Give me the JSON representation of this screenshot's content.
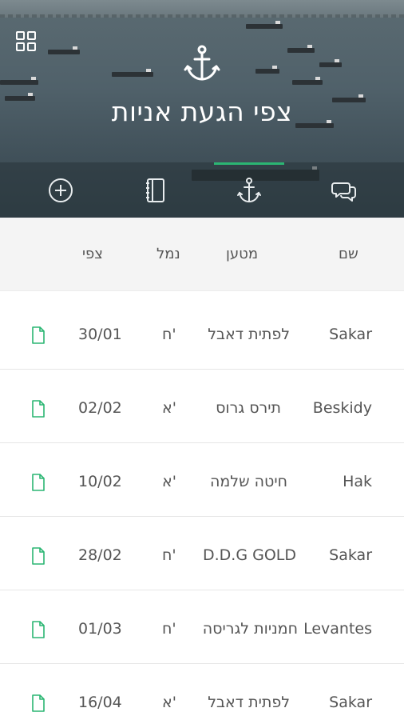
{
  "header": {
    "title": "צפי הגעת אניות"
  },
  "icons": {
    "menu": "grid-icon",
    "header_logo": "anchor-icon"
  },
  "tabs": [
    {
      "name": "tab-add",
      "icon": "plus-circle-icon",
      "active": false
    },
    {
      "name": "tab-notebook",
      "icon": "notebook-icon",
      "active": false
    },
    {
      "name": "tab-ships",
      "icon": "anchor-icon",
      "active": true
    },
    {
      "name": "tab-chat",
      "icon": "chat-bubbles-icon",
      "active": false
    }
  ],
  "colors": {
    "accent": "#2bb673",
    "doc_icon": "#2bb673",
    "header_bg": "#f4f4f4"
  },
  "table": {
    "headers": {
      "name": "שם",
      "loader": "מטען",
      "port": "נמל",
      "eta": "צפי"
    },
    "rows": [
      {
        "name": "Sakar",
        "cargo": "לפתית דאבל",
        "port": "ח'",
        "eta": "30/01",
        "icon": "document-icon"
      },
      {
        "name": "Beskidy",
        "cargo": "תירס גרוס",
        "port": "א'",
        "eta": "02/02",
        "icon": "document-icon"
      },
      {
        "name": "Hak",
        "cargo": "חיטה שלמה",
        "port": "א'",
        "eta": "10/02",
        "icon": "document-icon"
      },
      {
        "name": "Sakar",
        "cargo": "D.D.G GOLD",
        "port": "ח'",
        "eta": "28/02",
        "icon": "document-icon"
      },
      {
        "name": "Levantes",
        "cargo": "חמניות לגריסה",
        "port": "ח'",
        "eta": "01/03",
        "icon": "document-icon"
      },
      {
        "name": "Sakar",
        "cargo": "לפתית דאבל",
        "port": "א'",
        "eta": "16/04",
        "icon": "document-icon"
      }
    ]
  }
}
